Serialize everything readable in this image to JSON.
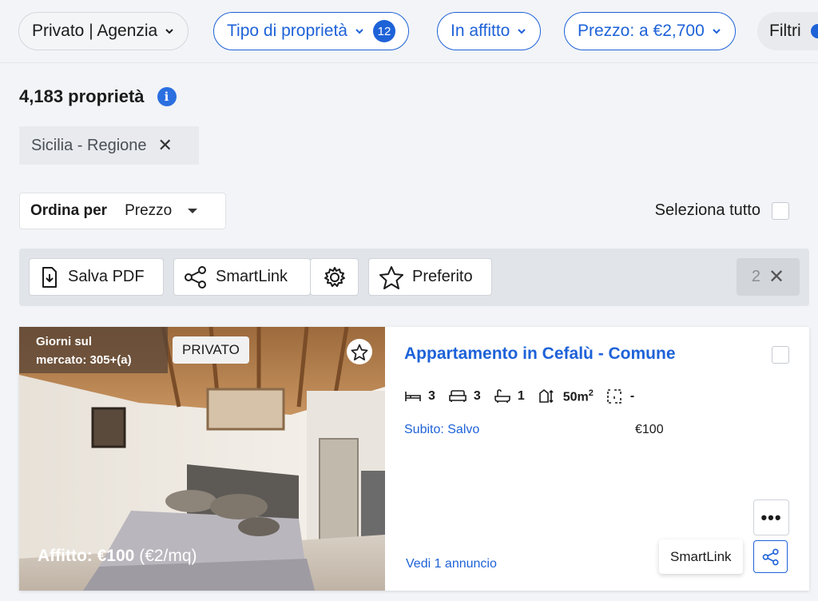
{
  "filters": {
    "type": "Privato | Agenzia",
    "property_type": "Tipo di proprietà",
    "property_type_count": "12",
    "rent": "In affitto",
    "price": "Prezzo: a €2,700",
    "more": "Filtri"
  },
  "results": {
    "count": "4,183 proprietà",
    "region_chip": "Sicilia - Regione"
  },
  "sort": {
    "label": "Ordina per",
    "value": "Prezzo"
  },
  "select_all": "Seleziona tutto",
  "toolbar": {
    "save_pdf": "Salva PDF",
    "smartlink": "SmartLink",
    "favorite": "Preferito",
    "selected_count": "2"
  },
  "listing": {
    "days_line1": "Giorni sul",
    "days_line2": "mercato: 305+(a)",
    "badge": "PRIVATO",
    "rent_label": "Affitto: €100",
    "rent_per_sqm": "(€2/mq)",
    "title": "Appartamento in Cefalù - Comune",
    "beds": "3",
    "sofas": "3",
    "baths": "1",
    "area": "50m",
    "area_unit_sup": "2",
    "floor": "-",
    "agent": "Subito: Salvo",
    "agent_price": "€100",
    "see_listings": "Vedi 1 annuncio",
    "more_button": "•••",
    "share_tooltip": "SmartLink"
  },
  "colors": {
    "accent": "#1e62d8",
    "background": "#f2f4f7"
  }
}
